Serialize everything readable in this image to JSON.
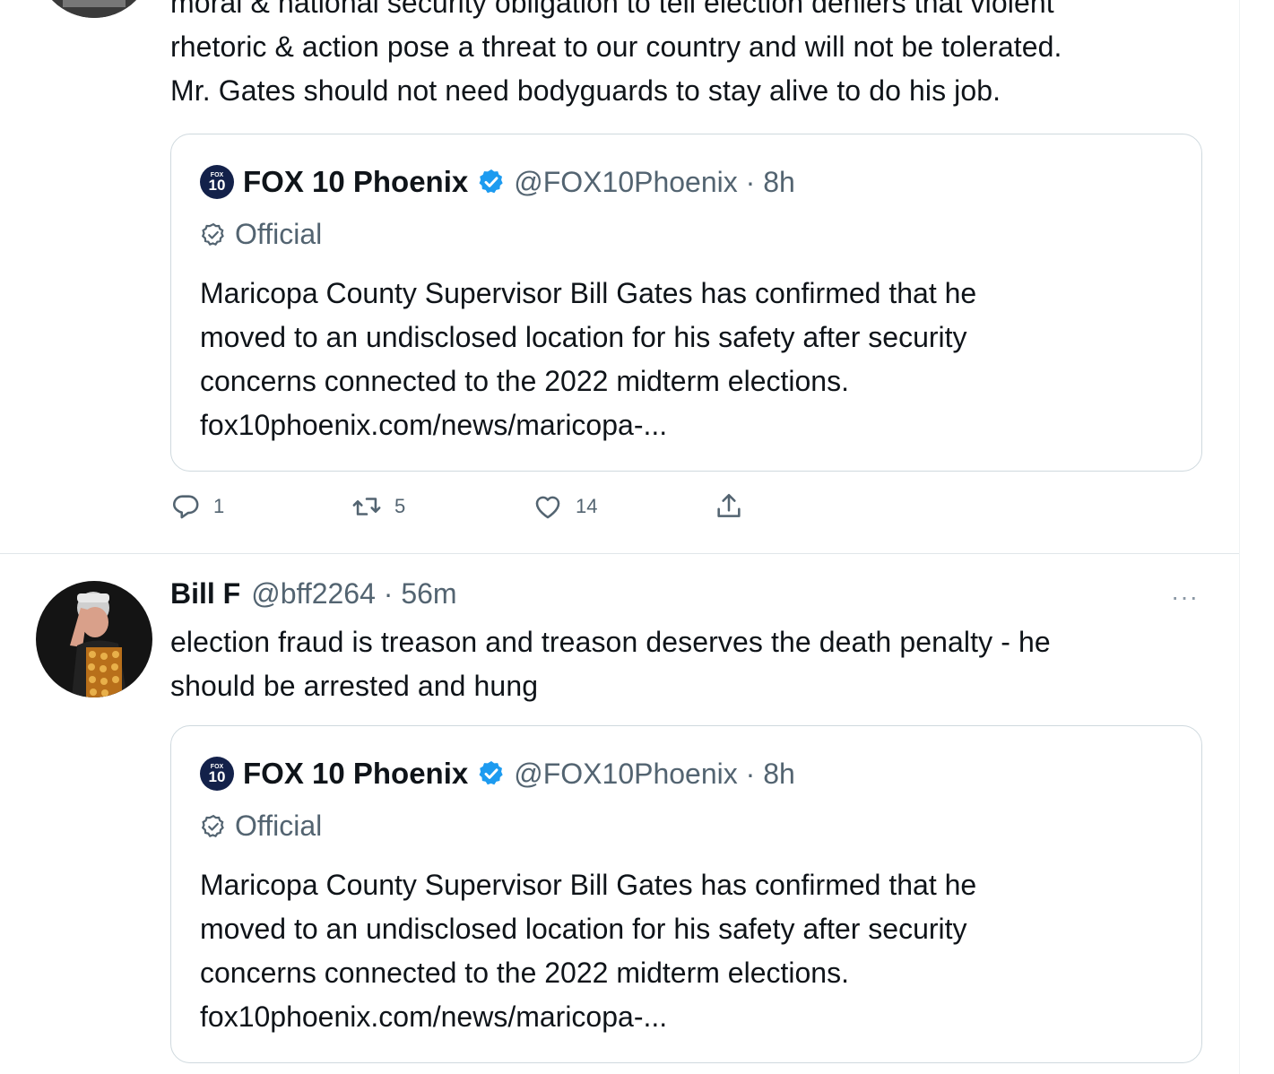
{
  "tweet_above": {
    "text_lines": [
      "moral & national security obligation to tell election deniers that violent",
      "rhetoric & action pose a threat to our country and will not be tolerated.",
      "Mr. Gates should not need bodyguards to stay alive to do his job."
    ],
    "quote": {
      "logo_small": "FOX",
      "logo_big": "10",
      "name": "FOX 10 Phoenix",
      "handle_time": "@FOX10Phoenix · 8h",
      "official_label": "Official",
      "body_lines": [
        "Maricopa County Supervisor Bill Gates has confirmed that he",
        "moved to an undisclosed location for his safety after security",
        "concerns connected to the 2022 midterm elections.",
        "fox10phoenix.com/news/maricopa-..."
      ]
    },
    "actions": {
      "reply_count": "1",
      "retweet_count": "5",
      "like_count": "14"
    }
  },
  "tweet_below": {
    "name": "Bill F",
    "handle_time": "@bff2264 · 56m",
    "more_label": "···",
    "text_lines": [
      "election fraud is treason and treason deserves the death penalty - he",
      "should be arrested and hung"
    ],
    "quote": {
      "logo_small": "FOX",
      "logo_big": "10",
      "name": "FOX 10 Phoenix",
      "handle_time": "@FOX10Phoenix · 8h",
      "official_label": "Official",
      "body_lines": [
        "Maricopa County Supervisor Bill Gates has confirmed that he",
        "moved to an undisclosed location for his safety after security",
        "concerns connected to the 2022 midterm elections.",
        "fox10phoenix.com/news/maricopa-..."
      ]
    }
  },
  "colors": {
    "text_primary": "#0f1419",
    "text_secondary": "#536471",
    "verified_blue": "#1d9bf0",
    "border": "#cfd9de"
  }
}
